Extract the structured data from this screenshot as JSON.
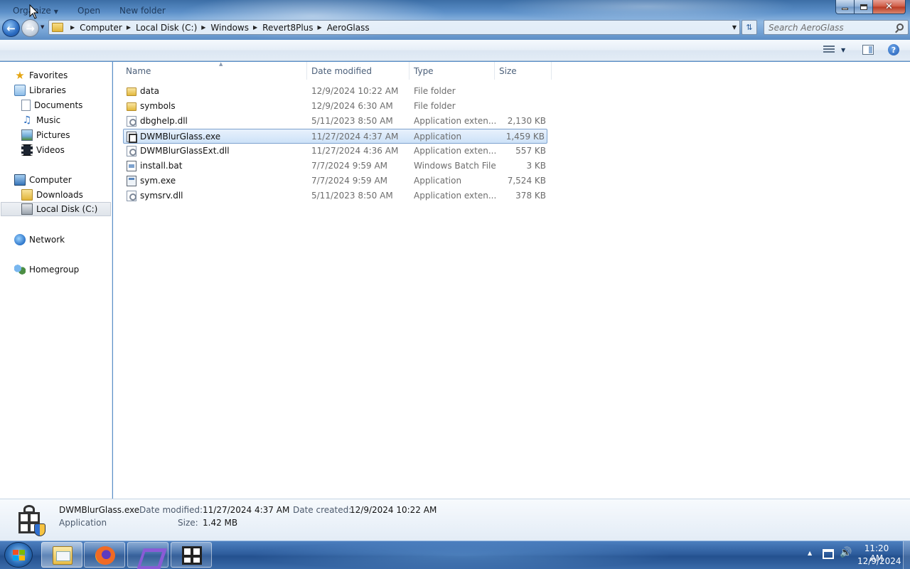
{
  "window": {
    "controls": {
      "minimize": "minimize",
      "maximize": "maximize",
      "close": "✕"
    }
  },
  "address": {
    "breadcrumbs": [
      "Computer",
      "Local Disk (C:)",
      "Windows",
      "Revert8Plus",
      "AeroGlass"
    ]
  },
  "search": {
    "placeholder": "Search AeroGlass"
  },
  "toolbar": {
    "organize_label": "Organize",
    "open_label": "Open",
    "new_folder_label": "New folder"
  },
  "nav": {
    "favorites": "Favorites",
    "libraries": "Libraries",
    "documents": "Documents",
    "music": "Music",
    "pictures": "Pictures",
    "videos": "Videos",
    "computer": "Computer",
    "downloads": "Downloads",
    "local_disk": "Local Disk (C:)",
    "network": "Network",
    "homegroup": "Homegroup"
  },
  "columns": {
    "name": "Name",
    "date": "Date modified",
    "type": "Type",
    "size": "Size"
  },
  "files": [
    {
      "name": "data",
      "date": "12/9/2024 10:22 AM",
      "type": "File folder",
      "size": "",
      "icon": "folder-icon"
    },
    {
      "name": "symbols",
      "date": "12/9/2024 6:30 AM",
      "type": "File folder",
      "size": "",
      "icon": "folder-icon"
    },
    {
      "name": "dbghelp.dll",
      "date": "5/11/2023 8:50 AM",
      "type": "Application exten...",
      "size": "2,130 KB",
      "icon": "dll-file-icon"
    },
    {
      "name": "DWMBlurGlass.exe",
      "date": "11/27/2024 4:37 AM",
      "type": "Application",
      "size": "1,459 KB",
      "icon": "app-icon",
      "selected": true
    },
    {
      "name": "DWMBlurGlassExt.dll",
      "date": "11/27/2024 4:36 AM",
      "type": "Application exten...",
      "size": "557 KB",
      "icon": "dll-file-icon"
    },
    {
      "name": "install.bat",
      "date": "7/7/2024 9:59 AM",
      "type": "Windows Batch File",
      "size": "3 KB",
      "icon": "batch-file-icon"
    },
    {
      "name": "sym.exe",
      "date": "7/7/2024 9:59 AM",
      "type": "Application",
      "size": "7,524 KB",
      "icon": "exe-icon"
    },
    {
      "name": "symsrv.dll",
      "date": "5/11/2023 8:50 AM",
      "type": "Application exten...",
      "size": "378 KB",
      "icon": "dll-file-icon"
    }
  ],
  "details": {
    "name": "DWMBlurGlass.exe",
    "type": "Application",
    "date_modified_label": "Date modified:",
    "date_modified": "11/27/2024 4:37 AM",
    "date_created_label": "Date created:",
    "date_created": "12/9/2024 10:22 AM",
    "size_label": "Size:",
    "size": "1.42 MB"
  },
  "taskbar": {
    "apps": [
      "windows-explorer",
      "firefox",
      "visual-studio",
      "dwmblurglass"
    ],
    "active_app": "windows-explorer",
    "clock_time": "11:20 AM",
    "clock_date": "12/9/2024"
  },
  "colors": {
    "selection": "#cde2f8",
    "selection_border": "#7da2ce",
    "link_text": "#1e395b"
  }
}
